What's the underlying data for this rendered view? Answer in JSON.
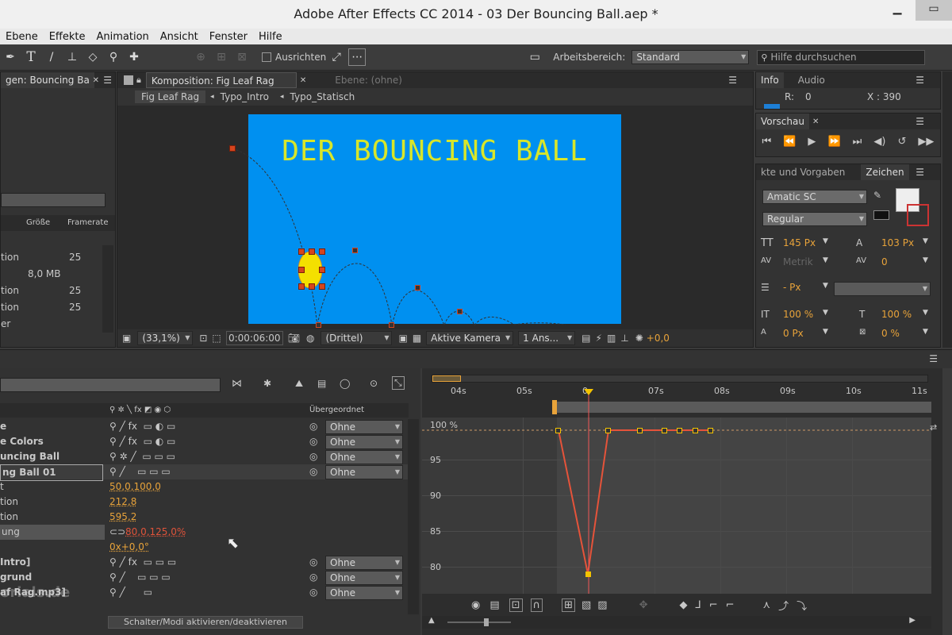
{
  "window": {
    "title": "Adobe After Effects CC 2014 - 03 Der Bouncing Ball.aep *"
  },
  "menu": [
    "Ebene",
    "Effekte",
    "Animation",
    "Ansicht",
    "Fenster",
    "Hilfe"
  ],
  "toolbar": {
    "align_label": "Ausrichten",
    "workspace_label": "Arbeitsbereich:",
    "workspace_value": "Standard",
    "search_placeholder": "Hilfe durchsuchen"
  },
  "project": {
    "tab": "gen: Bouncing Ba",
    "col_size": "Größe",
    "col_framerate": "Framerate",
    "rows": [
      {
        "name": "tion",
        "size": "",
        "fr": "25"
      },
      {
        "name": "",
        "size": "8,0 MB",
        "fr": ""
      },
      {
        "name": "tion",
        "size": "",
        "fr": "25"
      },
      {
        "name": "tion",
        "size": "",
        "fr": "25"
      },
      {
        "name": "er",
        "size": "",
        "fr": ""
      }
    ]
  },
  "comp": {
    "tab": "Komposition: Fig Leaf Rag",
    "layer_tab": "Ebene: (ohne)",
    "breadcrumbs": [
      "Fig Leaf Rag",
      "Typo_Intro",
      "Typo_Statisch"
    ],
    "canvas_title": "DER BOUNCING BALL",
    "zoom": "(33,1%)",
    "timecode": "0:00:06:00",
    "resolution": "(Drittel)",
    "camera": "Aktive Kamera",
    "views": "1 Ans...",
    "exposure": "+0,0"
  },
  "info": {
    "tab_info": "Info",
    "tab_audio": "Audio",
    "r_label": "R:",
    "r_value": "0",
    "x_label": "X : 390"
  },
  "preview": {
    "tab": "Vorschau"
  },
  "character": {
    "tab_effects": "kte und Vorgaben",
    "tab_char": "Zeichen",
    "font": "Amatic SC",
    "style": "Regular",
    "size": "145 Px",
    "leading": "103 Px",
    "kerning": "Metrik",
    "tracking": "0",
    "stroke": "- Px",
    "vscale": "100 %",
    "hscale": "100 %",
    "baseline": "0 Px",
    "tsume": "0 %"
  },
  "timeline": {
    "parent_label": "Übergeordnet",
    "layers": [
      {
        "name": "e",
        "parent": "Ohne"
      },
      {
        "name": "e Colors",
        "parent": "Ohne"
      },
      {
        "name": "uncing Ball",
        "parent": "Ohne"
      },
      {
        "name": "ng Ball 01",
        "parent": "Ohne"
      }
    ],
    "props": [
      {
        "name": "t",
        "value": "50,0,100,0"
      },
      {
        "name": "tion",
        "value": "212,8"
      },
      {
        "name": "tion",
        "value": "595,2"
      },
      {
        "name": "ung",
        "value": "80,0,125,0%"
      },
      {
        "name": "",
        "value": "0x+0,0°"
      }
    ],
    "layers2": [
      {
        "name": "Intro]",
        "parent": "Ohne"
      },
      {
        "name": "grund",
        "parent": "Ohne"
      },
      {
        "name": "af Rag.mp3]",
        "parent": "Ohne"
      }
    ],
    "toggle_label": "Schalter/Modi aktivieren/deaktivieren",
    "watermark": "orials.de",
    "ruler": [
      "04s",
      "05s",
      "0",
      "07s",
      "08s",
      "09s",
      "10s",
      "11s"
    ],
    "graph_labels": [
      "100 %",
      "95",
      "90",
      "85",
      "80"
    ]
  }
}
